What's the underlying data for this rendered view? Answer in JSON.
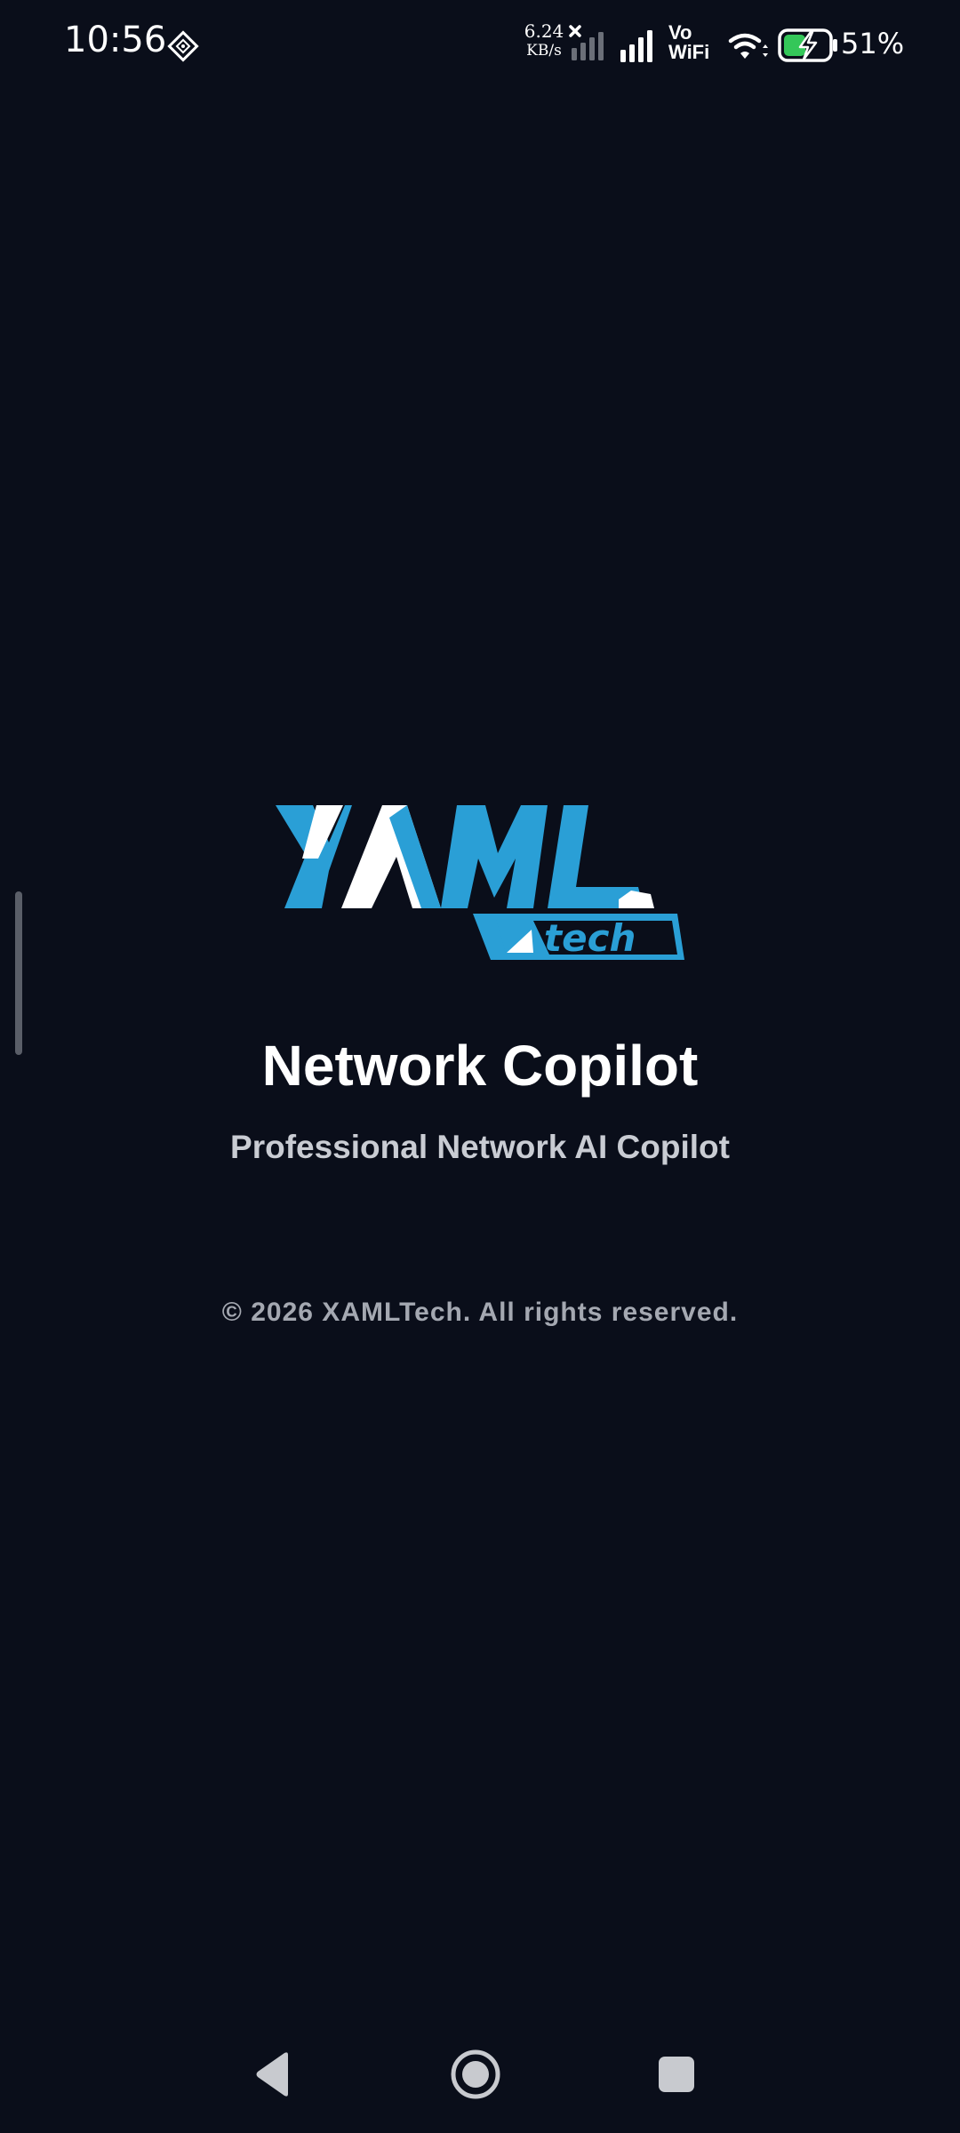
{
  "status_bar": {
    "time": "10:56",
    "left_icon": "notification-diamond-icon",
    "net_speed_value": "6.24",
    "net_speed_unit": "KB/s",
    "sim1_icon": "signal-no-service-icon",
    "sim2_icon": "signal-full-icon",
    "vowifi_top": "Vo",
    "vowifi_bottom": "WiFi",
    "wifi_icon": "wifi-icon",
    "battery_icon": "battery-charging-icon",
    "battery_percent": "51%",
    "battery_level": 0.51,
    "battery_accent": "#34c759"
  },
  "splash": {
    "logo_text": "XAML tech",
    "logo_primary_color": "#2a9fd6",
    "logo_secondary_color": "#ffffff",
    "title": "Network Copilot",
    "subtitle": "Professional Network AI Copilot",
    "copyright": "© 2026 XAMLTech. All rights reserved."
  },
  "nav_bar": {
    "back_icon": "back-triangle-icon",
    "home_icon": "home-circle-icon",
    "recents_icon": "recents-square-icon"
  },
  "theme": {
    "background": "#0a0e1a",
    "title_color": "#ffffff",
    "subtitle_color": "#c9ccd3",
    "copyright_color": "#a4a8b1"
  }
}
